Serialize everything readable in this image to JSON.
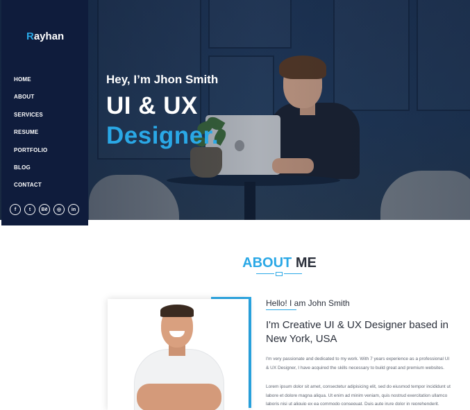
{
  "brand": {
    "first_letter": "R",
    "rest": "ayhan",
    "accent_color": "#2aa8e6"
  },
  "nav": {
    "items": [
      {
        "label": "HOME"
      },
      {
        "label": "ABOUT"
      },
      {
        "label": "SERVICES"
      },
      {
        "label": "RESUME"
      },
      {
        "label": "PORTFOLIO"
      },
      {
        "label": "BLOG"
      },
      {
        "label": "CONTACT"
      }
    ]
  },
  "social": [
    {
      "icon": "facebook-icon",
      "glyph": "f"
    },
    {
      "icon": "twitter-icon",
      "glyph": "t"
    },
    {
      "icon": "behance-icon",
      "glyph": "Bē"
    },
    {
      "icon": "instagram-icon",
      "glyph": "◎"
    },
    {
      "icon": "linkedin-icon",
      "glyph": "in"
    }
  ],
  "hero": {
    "greeting": "Hey, I’m Jhon Smith",
    "line1": "UI & UX",
    "line2": "Designer."
  },
  "about": {
    "title_part1": "ABOUT",
    "title_part2": "ME",
    "hello": "Hello! I am John Smith",
    "heading": "I'm Creative UI & UX Designer based in New York, USA",
    "para1": "I'm very passionate and dedicated to my work. With 7 years experience as a professional UI & UX Designer, I have acquired the skills necessary to build great and premium websites.",
    "para2": "Lorem ipsum dolor sit amet, consectetur adipisicing elit, sed do eiusmod tempor incididunt ut labore et dolore magna aliqua. Ut enim ad minim veniam, quis nostrud exercitation ullamco laboris nisi ut aliquip ex ea commodo consequat. Duis aute irure dolor in reprehenderit."
  },
  "colors": {
    "sidebar_bg": "#0f1c3c",
    "accent": "#2aa8e6",
    "text_dark": "#2a2f3a"
  }
}
